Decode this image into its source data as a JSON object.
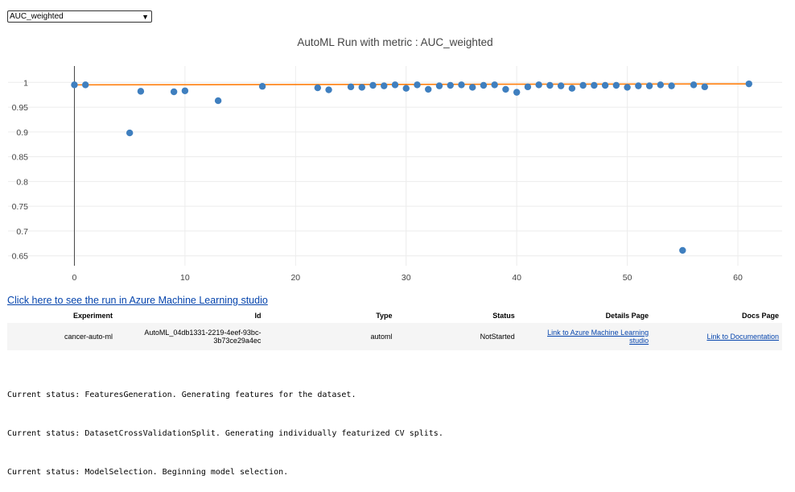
{
  "metric_dropdown": {
    "selected": "AUC_weighted",
    "caret_icon": "chevron-down-icon"
  },
  "chart_data": {
    "type": "scatter",
    "title": "AutoML Run with metric : AUC_weighted",
    "xlabel": "",
    "ylabel": "",
    "xlim": [
      -6,
      64
    ],
    "ylim": [
      0.63,
      1.02
    ],
    "x_ticks": [
      0,
      10,
      20,
      30,
      40,
      50,
      60
    ],
    "y_ticks": [
      0.65,
      0.7,
      0.75,
      0.8,
      0.85,
      0.9,
      0.95,
      1
    ],
    "y_tick_labels": [
      "0.65",
      "0.7",
      "0.75",
      "0.8",
      "0.85",
      "0.9",
      "0.95",
      "1"
    ],
    "grid": true,
    "legend": "none",
    "series": [
      {
        "type": "scatter",
        "color": "#3f7fbf",
        "x": [
          0,
          1,
          5,
          6,
          9,
          10,
          13,
          17,
          22,
          23,
          25,
          26,
          27,
          28,
          29,
          30,
          31,
          32,
          33,
          34,
          35,
          36,
          37,
          38,
          39,
          40,
          41,
          42,
          43,
          44,
          45,
          46,
          47,
          48,
          49,
          50,
          51,
          52,
          53,
          54,
          55,
          56,
          57,
          61
        ],
        "y": [
          0.995,
          0.995,
          0.898,
          0.982,
          0.981,
          0.983,
          0.963,
          0.992,
          0.989,
          0.985,
          0.991,
          0.99,
          0.994,
          0.993,
          0.995,
          0.988,
          0.995,
          0.986,
          0.993,
          0.994,
          0.995,
          0.99,
          0.994,
          0.995,
          0.986,
          0.98,
          0.991,
          0.995,
          0.994,
          0.993,
          0.988,
          0.994,
          0.994,
          0.994,
          0.994,
          0.99,
          0.993,
          0.993,
          0.995,
          0.993,
          0.661,
          0.995,
          0.991,
          0.997
        ]
      },
      {
        "type": "line",
        "color": "#ff7f0e",
        "x": [
          0,
          61
        ],
        "y": [
          0.995,
          0.997
        ]
      }
    ]
  },
  "studio_link": "Click here to see the run in Azure Machine Learning studio",
  "table": {
    "headers": [
      "Experiment",
      "Id",
      "Type",
      "Status",
      "Details Page",
      "Docs Page"
    ],
    "row": {
      "experiment": "cancer-auto-ml",
      "id_line1": "AutoML_04db1331-2219-4eef-93bc-",
      "id_line2": "3b73ce29a4ec",
      "type": "automl",
      "status": "NotStarted",
      "details_line1": "Link to Azure Machine Learning",
      "details_line2": "studio",
      "docs": "Link to Documentation"
    }
  },
  "status_log": [
    "Current status: FeaturesGeneration. Generating features for the dataset.",
    "Current status: DatasetCrossValidationSplit. Generating individually featurized CV splits.",
    "Current status: ModelSelection. Beginning model selection."
  ],
  "colors": {
    "accent": "#2a6db3",
    "marker": "#3f7fbf",
    "best_line": "#ff7f0e",
    "link": "#0645ad"
  }
}
